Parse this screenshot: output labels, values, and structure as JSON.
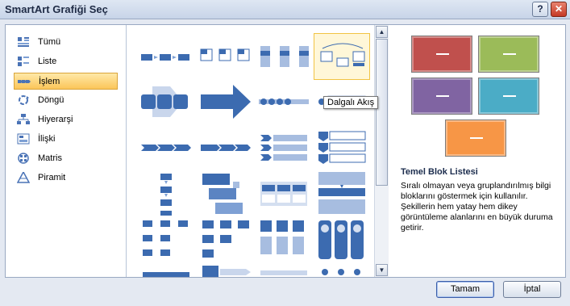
{
  "window": {
    "title": "SmartArt Grafiği Seç",
    "help_label": "?",
    "close_label": "✕"
  },
  "categories": [
    {
      "label": "Tümü",
      "icon": "all-grid-icon"
    },
    {
      "label": "Liste",
      "icon": "list-icon"
    },
    {
      "label": "İşlem",
      "icon": "process-icon",
      "selected": true
    },
    {
      "label": "Döngü",
      "icon": "cycle-icon"
    },
    {
      "label": "Hiyerarşi",
      "icon": "hierarchy-icon"
    },
    {
      "label": "İlişki",
      "icon": "relationship-icon"
    },
    {
      "label": "Matris",
      "icon": "matrix-icon"
    },
    {
      "label": "Piramit",
      "icon": "pyramid-icon"
    }
  ],
  "tooltip": "Dalgalı Akış",
  "preview": {
    "title": "Temel Blok Listesi",
    "description": "Sıralı olmayan veya gruplandırılmış bilgi bloklarını göstermek için kullanılır. Şekillerin hem yatay hem dikey görüntüleme alanlarını en büyük duruma getirir.",
    "block_label": "—",
    "colors": [
      "#c0504d",
      "#9bbb59",
      "#8064a2",
      "#4bacc6",
      "#f79646"
    ]
  },
  "buttons": {
    "ok": "Tamam",
    "cancel": "İptal"
  },
  "scrollbar": {
    "up": "▲",
    "down": "▼"
  }
}
